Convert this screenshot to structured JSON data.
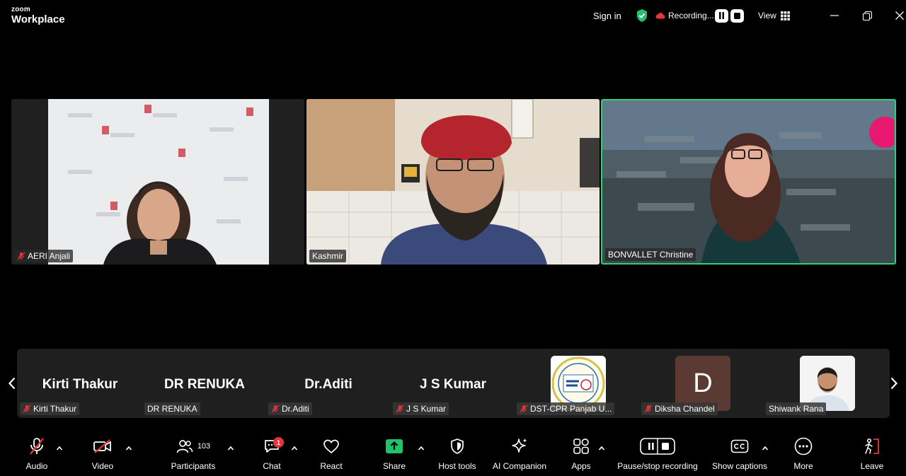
{
  "app": {
    "brand_top": "zoom",
    "brand_bottom": "Workplace"
  },
  "titlebar": {
    "sign_in": "Sign in",
    "recording": "Recording...",
    "view": "View"
  },
  "videos": [
    {
      "name": "AERI Anjali",
      "muted": true
    },
    {
      "name": "Kashmir",
      "muted": false
    },
    {
      "name": "BONVALLET Christine",
      "muted": false,
      "active_speaker": true
    }
  ],
  "gallery": [
    {
      "display": "Kirti Thakur",
      "name": "Kirti Thakur",
      "muted": true
    },
    {
      "display": "DR RENUKA",
      "name": "DR RENUKA",
      "muted": false
    },
    {
      "display": "Dr.Aditi",
      "name": "Dr.Aditi",
      "muted": true
    },
    {
      "display": "J S Kumar",
      "name": "J S Kumar",
      "muted": true
    },
    {
      "display": "",
      "name": "DST-CPR Panjab U...",
      "muted": true,
      "logo_text": "DST CPR"
    },
    {
      "display": "",
      "name": "Diksha Chandel",
      "muted": true,
      "initial": "D"
    },
    {
      "display": "",
      "name": "Shiwank Rana",
      "muted": false
    }
  ],
  "toolbar": {
    "audio": "Audio",
    "video": "Video",
    "participants": "Participants",
    "participants_count": "103",
    "chat": "Chat",
    "chat_badge": "1",
    "react": "React",
    "share": "Share",
    "host_tools": "Host tools",
    "ai_companion": "AI Companion",
    "apps": "Apps",
    "pause_stop": "Pause/stop recording",
    "captions": "Show captions",
    "more": "More",
    "leave": "Leave"
  },
  "colors": {
    "active_speaker_border": "#2fd07a",
    "share_green": "#23c16b",
    "mute_red": "#e5353b",
    "brand_pink": "#e8176f"
  }
}
